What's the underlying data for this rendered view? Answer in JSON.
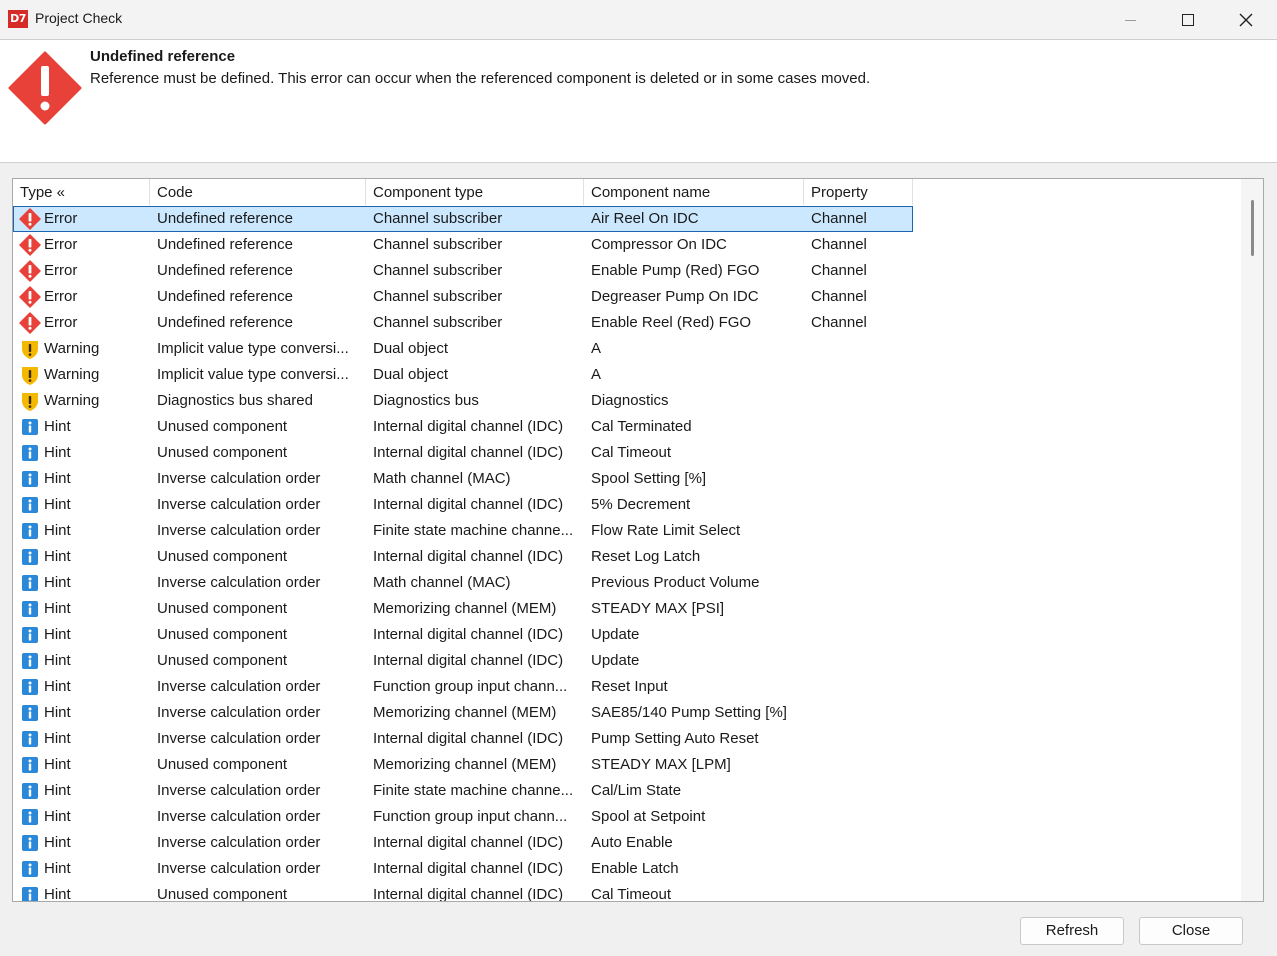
{
  "window": {
    "logo_text": "D7",
    "title": "Project Check"
  },
  "message": {
    "title": "Undefined reference",
    "description": "Reference must be defined. This error can occur when the referenced component is deleted or in some cases moved."
  },
  "table": {
    "headers": {
      "type": "Type «",
      "code": "Code",
      "component_type": "Component type",
      "component_name": "Component name",
      "property": "Property"
    },
    "rows": [
      {
        "type": "Error",
        "icon": "error-icon",
        "code": "Undefined reference",
        "component_type": "Channel subscriber",
        "component_name": "Air Reel On IDC",
        "property": "Channel",
        "selected": true
      },
      {
        "type": "Error",
        "icon": "error-icon",
        "code": "Undefined reference",
        "component_type": "Channel subscriber",
        "component_name": "Compressor On IDC",
        "property": "Channel"
      },
      {
        "type": "Error",
        "icon": "error-icon",
        "code": "Undefined reference",
        "component_type": "Channel subscriber",
        "component_name": "Enable Pump (Red) FGO",
        "property": "Channel"
      },
      {
        "type": "Error",
        "icon": "error-icon",
        "code": "Undefined reference",
        "component_type": "Channel subscriber",
        "component_name": "Degreaser Pump On IDC",
        "property": "Channel"
      },
      {
        "type": "Error",
        "icon": "error-icon",
        "code": "Undefined reference",
        "component_type": "Channel subscriber",
        "component_name": "Enable Reel (Red) FGO",
        "property": "Channel"
      },
      {
        "type": "Warning",
        "icon": "warning-icon",
        "code": "Implicit value type conversi...",
        "component_type": "Dual object",
        "component_name": "A",
        "property": ""
      },
      {
        "type": "Warning",
        "icon": "warning-icon",
        "code": "Implicit value type conversi...",
        "component_type": "Dual object",
        "component_name": "A",
        "property": ""
      },
      {
        "type": "Warning",
        "icon": "warning-icon",
        "code": "Diagnostics bus shared",
        "component_type": "Diagnostics bus",
        "component_name": "Diagnostics",
        "property": ""
      },
      {
        "type": "Hint",
        "icon": "info-icon",
        "code": "Unused component",
        "component_type": "Internal digital channel (IDC)",
        "component_name": "Cal Terminated",
        "property": ""
      },
      {
        "type": "Hint",
        "icon": "info-icon",
        "code": "Unused component",
        "component_type": "Internal digital channel (IDC)",
        "component_name": "Cal Timeout",
        "property": ""
      },
      {
        "type": "Hint",
        "icon": "info-icon",
        "code": "Inverse calculation order",
        "component_type": "Math channel (MAC)",
        "component_name": "Spool Setting [%]",
        "property": ""
      },
      {
        "type": "Hint",
        "icon": "info-icon",
        "code": "Inverse calculation order",
        "component_type": "Internal digital channel (IDC)",
        "component_name": "5% Decrement",
        "property": ""
      },
      {
        "type": "Hint",
        "icon": "info-icon",
        "code": "Inverse calculation order",
        "component_type": "Finite state machine channe...",
        "component_name": "Flow Rate Limit Select",
        "property": ""
      },
      {
        "type": "Hint",
        "icon": "info-icon",
        "code": "Unused component",
        "component_type": "Internal digital channel (IDC)",
        "component_name": "Reset Log Latch",
        "property": ""
      },
      {
        "type": "Hint",
        "icon": "info-icon",
        "code": "Inverse calculation order",
        "component_type": "Math channel (MAC)",
        "component_name": "Previous Product Volume",
        "property": ""
      },
      {
        "type": "Hint",
        "icon": "info-icon",
        "code": "Unused component",
        "component_type": "Memorizing channel (MEM)",
        "component_name": "STEADY MAX [PSI]",
        "property": ""
      },
      {
        "type": "Hint",
        "icon": "info-icon",
        "code": "Unused component",
        "component_type": "Internal digital channel (IDC)",
        "component_name": "Update",
        "property": ""
      },
      {
        "type": "Hint",
        "icon": "info-icon",
        "code": "Unused component",
        "component_type": "Internal digital channel (IDC)",
        "component_name": "Update",
        "property": ""
      },
      {
        "type": "Hint",
        "icon": "info-icon",
        "code": "Inverse calculation order",
        "component_type": "Function group input chann...",
        "component_name": "Reset Input",
        "property": ""
      },
      {
        "type": "Hint",
        "icon": "info-icon",
        "code": "Inverse calculation order",
        "component_type": "Memorizing channel (MEM)",
        "component_name": "SAE85/140 Pump Setting [%]",
        "property": ""
      },
      {
        "type": "Hint",
        "icon": "info-icon",
        "code": "Inverse calculation order",
        "component_type": "Internal digital channel (IDC)",
        "component_name": "Pump Setting Auto Reset",
        "property": ""
      },
      {
        "type": "Hint",
        "icon": "info-icon",
        "code": "Unused component",
        "component_type": "Memorizing channel (MEM)",
        "component_name": "STEADY MAX [LPM]",
        "property": ""
      },
      {
        "type": "Hint",
        "icon": "info-icon",
        "code": "Inverse calculation order",
        "component_type": "Finite state machine channe...",
        "component_name": "Cal/Lim State",
        "property": ""
      },
      {
        "type": "Hint",
        "icon": "info-icon",
        "code": "Inverse calculation order",
        "component_type": "Function group input chann...",
        "component_name": "Spool at Setpoint",
        "property": ""
      },
      {
        "type": "Hint",
        "icon": "info-icon",
        "code": "Inverse calculation order",
        "component_type": "Internal digital channel (IDC)",
        "component_name": "Auto Enable",
        "property": ""
      },
      {
        "type": "Hint",
        "icon": "info-icon",
        "code": "Inverse calculation order",
        "component_type": "Internal digital channel (IDC)",
        "component_name": "Enable Latch",
        "property": ""
      },
      {
        "type": "Hint",
        "icon": "info-icon",
        "code": "Unused component",
        "component_type": "Internal digital channel (IDC)",
        "component_name": "Cal Timeout",
        "property": ""
      }
    ]
  },
  "buttons": {
    "refresh": "Refresh",
    "close": "Close"
  },
  "colors": {
    "error": "#e8413a",
    "warning": "#f5b800",
    "info": "#2b88d8",
    "selection": "#cce8ff",
    "selection_border": "#1c63b0",
    "logo_bg": "#d62b26"
  }
}
